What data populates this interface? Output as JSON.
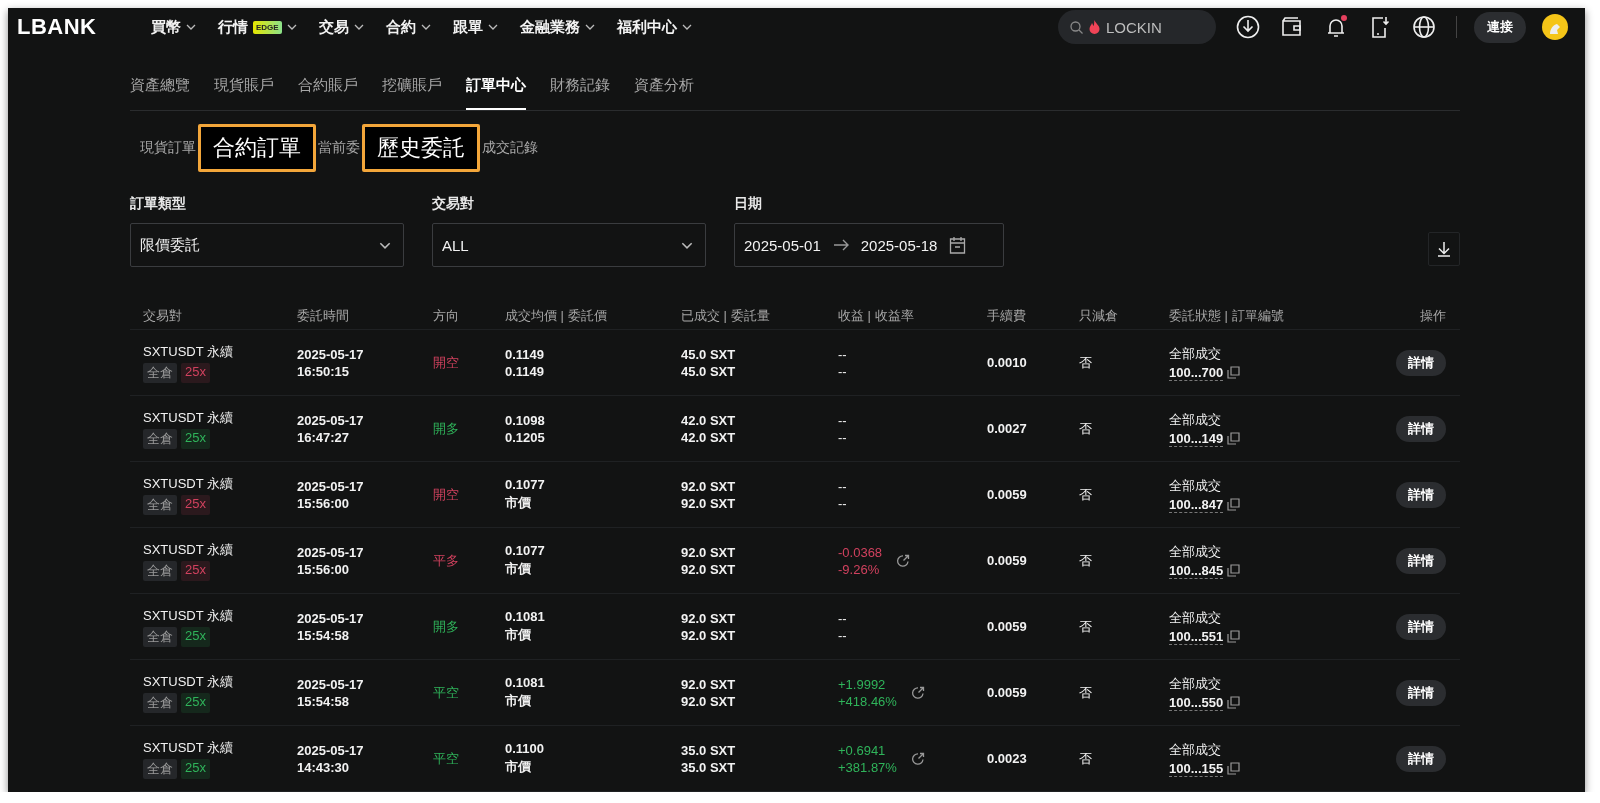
{
  "header": {
    "logo": "LBANK",
    "nav": [
      {
        "label": "買幣"
      },
      {
        "label": "行情",
        "badge": "EDGE"
      },
      {
        "label": "交易"
      },
      {
        "label": "合約"
      },
      {
        "label": "跟單"
      },
      {
        "label": "金融業務"
      },
      {
        "label": "福利中心"
      }
    ],
    "search": {
      "value": "LOCKIN"
    },
    "notification": true,
    "connect_button": "連接"
  },
  "tabs": [
    {
      "label": "資產總覽",
      "selected": false
    },
    {
      "label": "現貨賬戶",
      "selected": false
    },
    {
      "label": "合約賬戶",
      "selected": false
    },
    {
      "label": "挖礦賬戶",
      "selected": false
    },
    {
      "label": "訂單中心",
      "selected": true
    },
    {
      "label": "財務記錄",
      "selected": false
    },
    {
      "label": "資產分析",
      "selected": false
    }
  ],
  "subtabs": [
    {
      "label": "現貨訂單",
      "highlighted": false
    },
    {
      "label": "合約訂單",
      "highlighted": true
    },
    {
      "label": "當前委",
      "highlighted": false
    },
    {
      "label": "歷史委託",
      "highlighted": true
    },
    {
      "label": "成交記錄",
      "highlighted": false
    }
  ],
  "filters": {
    "order_type": {
      "label": "訂單類型",
      "value": "限價委託"
    },
    "pair": {
      "label": "交易對",
      "value": "ALL"
    },
    "date": {
      "label": "日期",
      "start": "2025-05-01",
      "end": "2025-05-18"
    }
  },
  "table": {
    "columns": [
      "交易對",
      "委託時間",
      "方向",
      "成交均價 | 委託價",
      "已成交 | 委託量",
      "收益 | 收益率",
      "手續費",
      "只減倉",
      "委託狀態 | 訂單編號",
      "操作"
    ],
    "rows": [
      {
        "pair": "SXTUSDT 永續",
        "margin": "全倉",
        "leverage": "25x",
        "color": "#d0415e",
        "date": "2025-05-17",
        "time": "16:50:15",
        "direction": "開空",
        "avg_price": "0.1149",
        "order_price": "0.1149",
        "filled": "45.0 SXT",
        "amount": "45.0 SXT",
        "pnl": "--",
        "pnl_rate": "--",
        "shareable": false,
        "fee": "0.0010",
        "reduce_only": "否",
        "status": "全部成交",
        "order_id": "100...700",
        "action": "詳情"
      },
      {
        "pair": "SXTUSDT 永續",
        "margin": "全倉",
        "leverage": "25x",
        "color": "#2fb35a",
        "date": "2025-05-17",
        "time": "16:47:27",
        "direction": "開多",
        "avg_price": "0.1098",
        "order_price": "0.1205",
        "filled": "42.0 SXT",
        "amount": "42.0 SXT",
        "pnl": "--",
        "pnl_rate": "--",
        "shareable": false,
        "fee": "0.0027",
        "reduce_only": "否",
        "status": "全部成交",
        "order_id": "100...149",
        "action": "詳情"
      },
      {
        "pair": "SXTUSDT 永續",
        "margin": "全倉",
        "leverage": "25x",
        "color": "#d0415e",
        "date": "2025-05-17",
        "time": "15:56:00",
        "direction": "開空",
        "avg_price": "0.1077",
        "order_price": "市價",
        "filled": "92.0 SXT",
        "amount": "92.0 SXT",
        "pnl": "--",
        "pnl_rate": "--",
        "shareable": false,
        "fee": "0.0059",
        "reduce_only": "否",
        "status": "全部成交",
        "order_id": "100...847",
        "action": "詳情"
      },
      {
        "pair": "SXTUSDT 永續",
        "margin": "全倉",
        "leverage": "25x",
        "color": "#d0415e",
        "date": "2025-05-17",
        "time": "15:56:00",
        "direction": "平多",
        "avg_price": "0.1077",
        "order_price": "市價",
        "filled": "92.0 SXT",
        "amount": "92.0 SXT",
        "pnl": "-0.0368",
        "pnl_rate": "-9.26%",
        "shareable": true,
        "fee": "0.0059",
        "reduce_only": "否",
        "status": "全部成交",
        "order_id": "100...845",
        "action": "詳情"
      },
      {
        "pair": "SXTUSDT 永續",
        "margin": "全倉",
        "leverage": "25x",
        "color": "#2fb35a",
        "date": "2025-05-17",
        "time": "15:54:58",
        "direction": "開多",
        "avg_price": "0.1081",
        "order_price": "市價",
        "filled": "92.0 SXT",
        "amount": "92.0 SXT",
        "pnl": "--",
        "pnl_rate": "--",
        "shareable": false,
        "fee": "0.0059",
        "reduce_only": "否",
        "status": "全部成交",
        "order_id": "100...551",
        "action": "詳情"
      },
      {
        "pair": "SXTUSDT 永續",
        "margin": "全倉",
        "leverage": "25x",
        "color": "#2fb35a",
        "date": "2025-05-17",
        "time": "15:54:58",
        "direction": "平空",
        "avg_price": "0.1081",
        "order_price": "市價",
        "filled": "92.0 SXT",
        "amount": "92.0 SXT",
        "pnl": "+1.9992",
        "pnl_rate": "+418.46%",
        "shareable": true,
        "fee": "0.0059",
        "reduce_only": "否",
        "status": "全部成交",
        "order_id": "100...550",
        "action": "詳情"
      },
      {
        "pair": "SXTUSDT 永續",
        "margin": "全倉",
        "leverage": "25x",
        "color": "#2fb35a",
        "date": "2025-05-17",
        "time": "14:43:30",
        "direction": "平空",
        "avg_price": "0.1100",
        "order_price": "市價",
        "filled": "35.0 SXT",
        "amount": "35.0 SXT",
        "pnl": "+0.6941",
        "pnl_rate": "+381.87%",
        "shareable": true,
        "fee": "0.0023",
        "reduce_only": "否",
        "status": "全部成交",
        "order_id": "100...155",
        "action": "詳情"
      }
    ]
  }
}
